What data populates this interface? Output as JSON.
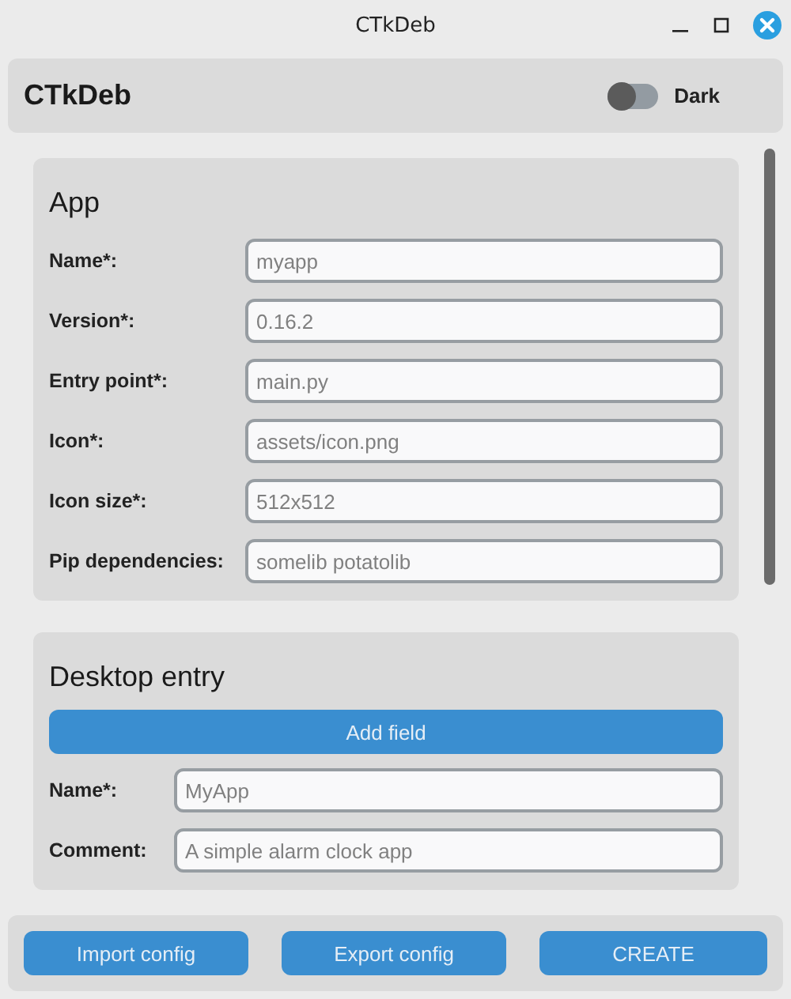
{
  "window": {
    "title": "CTkDeb"
  },
  "header": {
    "title": "CTkDeb",
    "dark_switch": {
      "label": "Dark",
      "on": false
    }
  },
  "sections": [
    {
      "title": "App",
      "fields": [
        {
          "label": "Name*:",
          "placeholder": "myapp"
        },
        {
          "label": "Version*:",
          "placeholder": "0.16.2"
        },
        {
          "label": "Entry point*:",
          "placeholder": "main.py"
        },
        {
          "label": "Icon*:",
          "placeholder": "assets/icon.png"
        },
        {
          "label": "Icon size*:",
          "placeholder": "512x512"
        },
        {
          "label": "Pip dependencies:",
          "placeholder": "somelib potatolib"
        }
      ]
    },
    {
      "title": "Desktop entry",
      "button": "Add field",
      "fields": [
        {
          "label": "Name*:",
          "placeholder": "MyApp"
        },
        {
          "label": "Comment:",
          "placeholder": "A simple alarm clock app"
        }
      ]
    }
  ],
  "footer_buttons": [
    "Import config",
    "Export config",
    "CREATE"
  ]
}
